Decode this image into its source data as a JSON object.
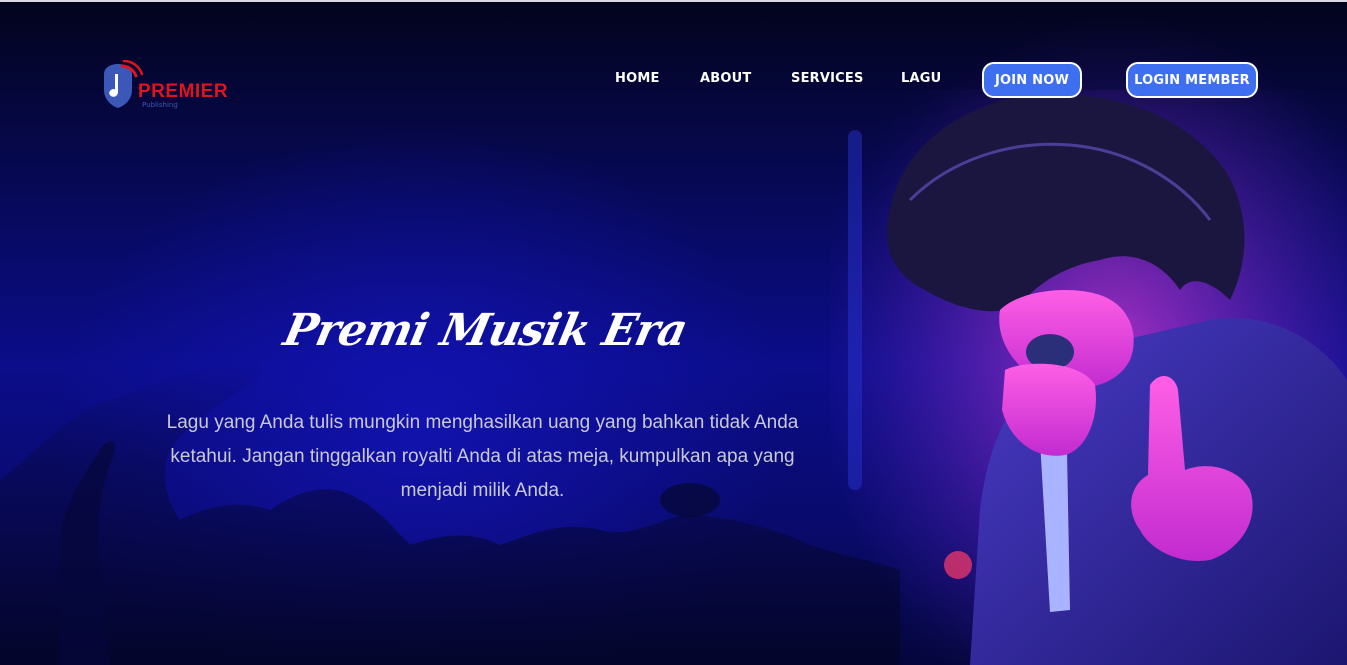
{
  "brand": {
    "name": "PREMIER",
    "tagline": "Publishing",
    "logo_icon": "music-note-shield-icon",
    "colors": {
      "primary": "#e0141f",
      "secondary": "#3b57b8"
    }
  },
  "nav": {
    "links": [
      "HOME",
      "ABOUT",
      "SERVICES",
      "LAGU"
    ],
    "join_label": "JOIN NOW",
    "login_label": "LOGIN MEMBER",
    "button_color": "#3e6ff0"
  },
  "hero": {
    "title": "Premi Musik Era",
    "description": "Lagu yang Anda tulis mungkin menghasilkan uang yang bahkan tidak Anda ketahui. Jangan tinggalkan royalti Anda di atas meja, kumpulkan apa yang menjadi milik Anda.",
    "background_color": "#0b0d8a"
  }
}
